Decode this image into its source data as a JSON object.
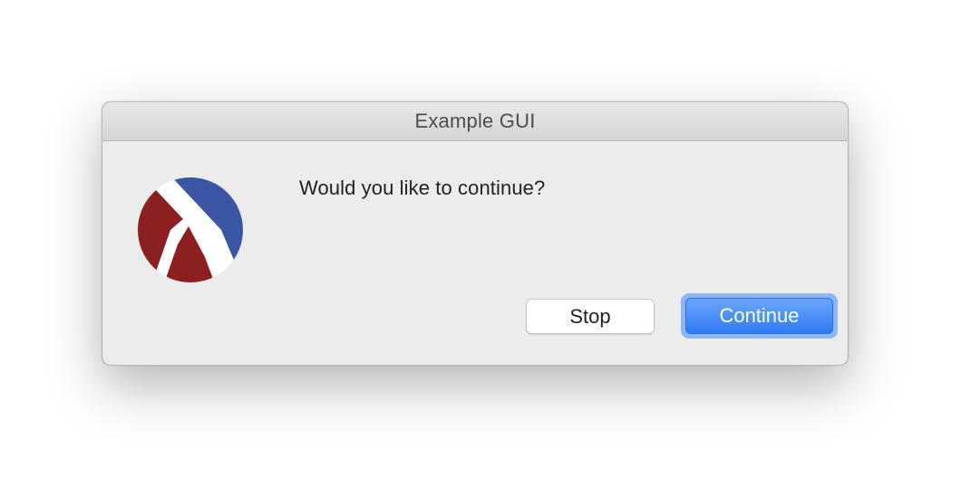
{
  "window": {
    "title": "Example GUI"
  },
  "dialog": {
    "icon": "racket-logo-icon",
    "message": "Would you like to continue?",
    "buttons": {
      "stop_label": "Stop",
      "continue_label": "Continue"
    }
  },
  "colors": {
    "logo_red": "#8c1f1f",
    "logo_blue": "#3a55a3",
    "default_button": "#3b82f6",
    "focus_ring": "#8eb6f3",
    "window_background": "#ececec"
  }
}
